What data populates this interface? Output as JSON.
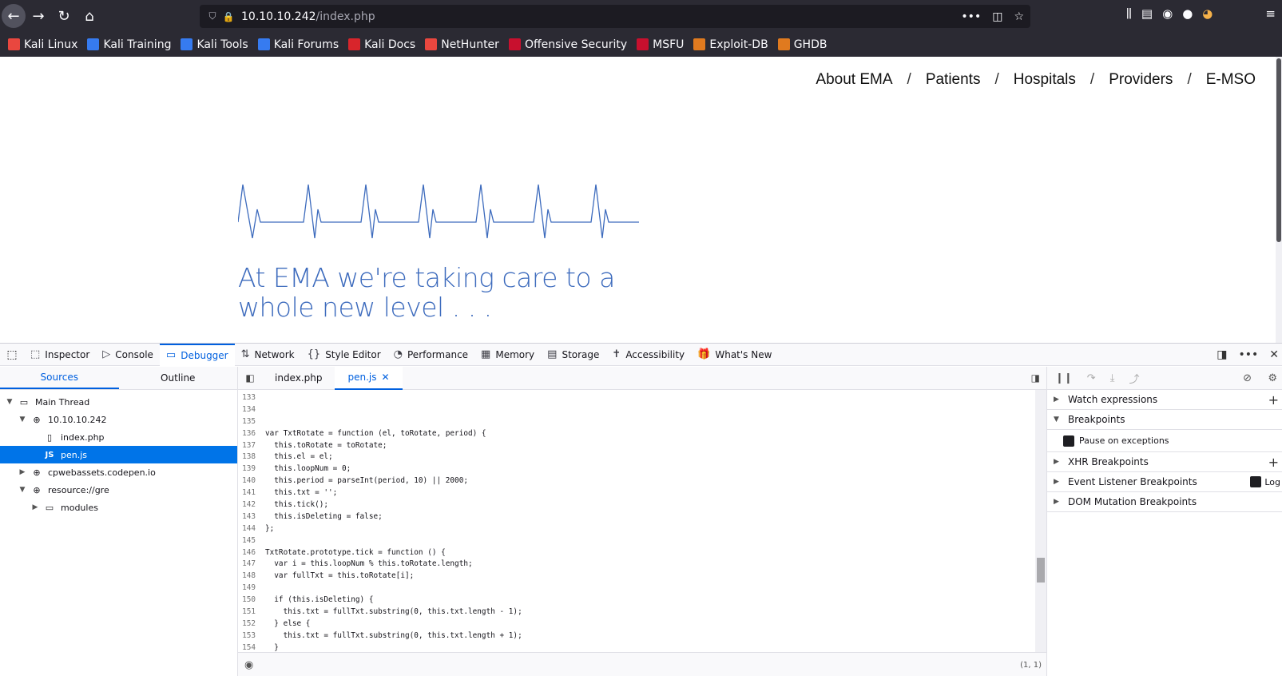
{
  "browser": {
    "url_host": "10.10.10.242",
    "url_path": "/index.php",
    "bookmarks": [
      {
        "label": "Kali Linux",
        "color": "#e9473f"
      },
      {
        "label": "Kali Training",
        "color": "#367bf0"
      },
      {
        "label": "Kali Tools",
        "color": "#367bf0"
      },
      {
        "label": "Kali Forums",
        "color": "#367bf0"
      },
      {
        "label": "Kali Docs",
        "color": "#d8252b"
      },
      {
        "label": "NetHunter",
        "color": "#e9473f"
      },
      {
        "label": "Offensive Security",
        "color": "#c8102e"
      },
      {
        "label": "MSFU",
        "color": "#c8102e"
      },
      {
        "label": "Exploit-DB",
        "color": "#e07a1f"
      },
      {
        "label": "GHDB",
        "color": "#e07a1f"
      }
    ]
  },
  "page": {
    "nav": [
      "About EMA",
      "Patients",
      "Hospitals",
      "Providers",
      "E-MSO"
    ],
    "nav_separator": "/",
    "headline_line1": "At EMA we're taking care to a",
    "headline_line2": "whole new level . . .",
    "accent_color": "#3d6bbd"
  },
  "devtools": {
    "tabs": [
      {
        "label": "Inspector",
        "icon": "inspector-icon",
        "glyph": "⬚"
      },
      {
        "label": "Console",
        "icon": "console-icon",
        "glyph": "▷"
      },
      {
        "label": "Debugger",
        "icon": "debugger-icon",
        "glyph": "▭",
        "active": true
      },
      {
        "label": "Network",
        "icon": "network-icon",
        "glyph": "⇅"
      },
      {
        "label": "Style Editor",
        "icon": "style-editor-icon",
        "glyph": "{}"
      },
      {
        "label": "Performance",
        "icon": "performance-icon",
        "glyph": "◔"
      },
      {
        "label": "Memory",
        "icon": "memory-icon",
        "glyph": "▦"
      },
      {
        "label": "Storage",
        "icon": "storage-icon",
        "glyph": "▤"
      },
      {
        "label": "Accessibility",
        "icon": "accessibility-icon",
        "glyph": "✝"
      },
      {
        "label": "What's New",
        "icon": "whats-new-icon",
        "glyph": "🎁"
      }
    ],
    "sources_tab": "Sources",
    "outline_tab": "Outline",
    "tree": [
      {
        "label": "Main Thread",
        "depth": 0,
        "twisty": "▼",
        "icon": "▭"
      },
      {
        "label": "10.10.10.242",
        "depth": 1,
        "twisty": "▼",
        "icon": "⊕"
      },
      {
        "label": "index.php",
        "depth": 2,
        "twisty": "",
        "icon": "▯"
      },
      {
        "label": "pen.js",
        "depth": 2,
        "twisty": "",
        "icon": "JS",
        "selected": true
      },
      {
        "label": "cpwebassets.codepen.io",
        "depth": 1,
        "twisty": "▶",
        "icon": "⊕"
      },
      {
        "label": "resource://gre",
        "depth": 1,
        "twisty": "▼",
        "icon": "⊕"
      },
      {
        "label": "modules",
        "depth": 2,
        "twisty": "▶",
        "icon": "▭"
      }
    ],
    "editor_tabs": [
      "index.php",
      "pen.js"
    ],
    "code_lines": [
      {
        "n": "133",
        "t": ""
      },
      {
        "n": "134",
        "t": ""
      },
      {
        "n": "135",
        "t": ""
      },
      {
        "n": "136",
        "t": "var TxtRotate = function (el, toRotate, period) {"
      },
      {
        "n": "137",
        "t": "  this.toRotate = toRotate;"
      },
      {
        "n": "138",
        "t": "  this.el = el;"
      },
      {
        "n": "139",
        "t": "  this.loopNum = 0;"
      },
      {
        "n": "140",
        "t": "  this.period = parseInt(period, 10) || 2000;"
      },
      {
        "n": "141",
        "t": "  this.txt = '';"
      },
      {
        "n": "142",
        "t": "  this.tick();"
      },
      {
        "n": "143",
        "t": "  this.isDeleting = false;"
      },
      {
        "n": "144",
        "t": "};"
      },
      {
        "n": "145",
        "t": ""
      },
      {
        "n": "146",
        "t": "TxtRotate.prototype.tick = function () {"
      },
      {
        "n": "147",
        "t": "  var i = this.loopNum % this.toRotate.length;"
      },
      {
        "n": "148",
        "t": "  var fullTxt = this.toRotate[i];"
      },
      {
        "n": "149",
        "t": ""
      },
      {
        "n": "150",
        "t": "  if (this.isDeleting) {"
      },
      {
        "n": "151",
        "t": "    this.txt = fullTxt.substring(0, this.txt.length - 1);"
      },
      {
        "n": "152",
        "t": "  } else {"
      },
      {
        "n": "153",
        "t": "    this.txt = fullTxt.substring(0, this.txt.length + 1);"
      },
      {
        "n": "154",
        "t": "  }"
      }
    ],
    "cursor_position": "(1, 1)",
    "right_panel": {
      "watch": "Watch expressions",
      "breakpoints": "Breakpoints",
      "pause_on_exceptions": "Pause on exceptions",
      "xhr": "XHR Breakpoints",
      "event_listener": "Event Listener Breakpoints",
      "log_label": "Log",
      "dom_mutation": "DOM Mutation Breakpoints"
    }
  }
}
